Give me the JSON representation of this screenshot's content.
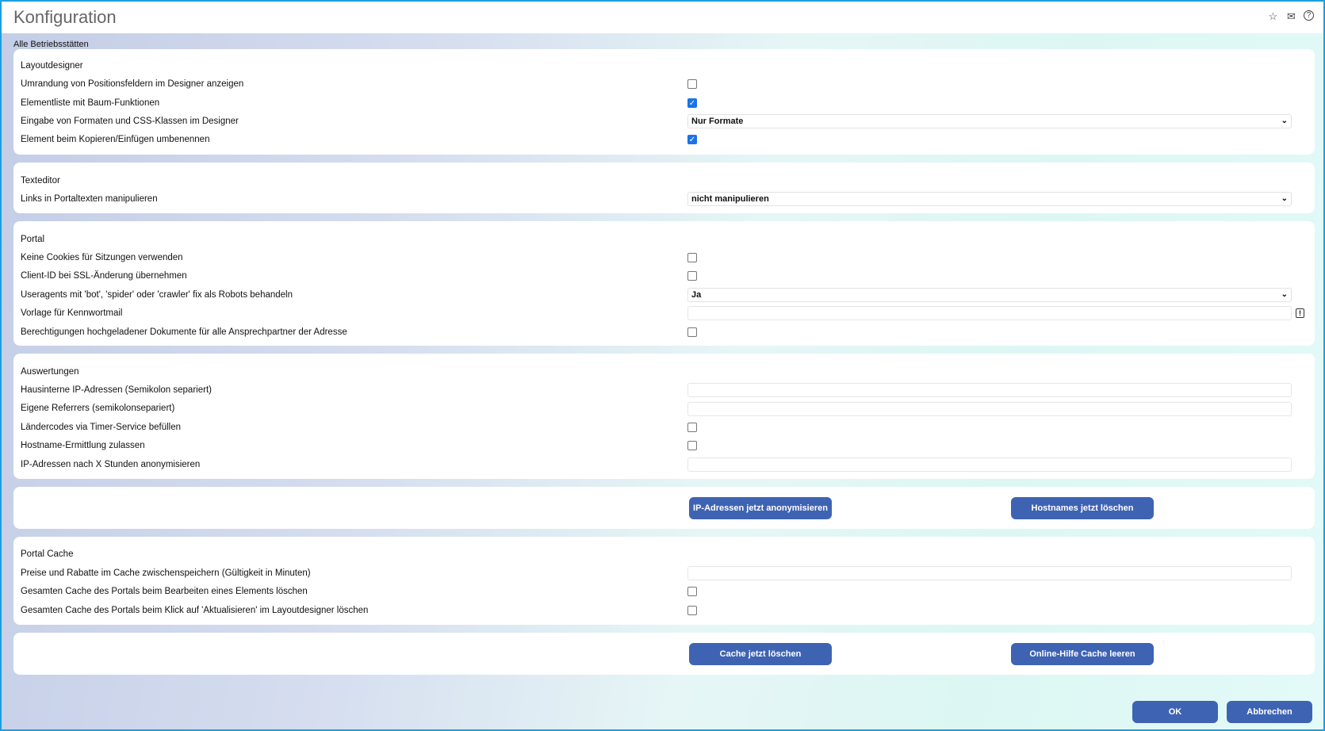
{
  "title": "Konfiguration",
  "scope": "Alle Betriebsstätten",
  "layoutdesigner": {
    "heading": "Layoutdesigner",
    "r1": "Umrandung von Positionsfeldern im Designer anzeigen",
    "r2": "Elementliste mit Baum-Funktionen",
    "r3": "Eingabe von Formaten und CSS-Klassen im Designer",
    "r3_value": "Nur Formate",
    "r4": "Element beim Kopieren/Einfügen umbenennen",
    "r1_checked": false,
    "r2_checked": true,
    "r4_checked": true
  },
  "texteditor": {
    "heading": "Texteditor",
    "r1": "Links in Portaltexten manipulieren",
    "r1_value": "nicht manipulieren"
  },
  "portal": {
    "heading": "Portal",
    "r1": "Keine Cookies für Sitzungen verwenden",
    "r2": "Client-ID bei SSL-Änderung übernehmen",
    "r3": "Useragents mit 'bot', 'spider' oder 'crawler' fix als Robots behandeln",
    "r3_value": "Ja",
    "r4": "Vorlage für Kennwortmail",
    "r4_value": "",
    "r5": "Berechtigungen hochgeladener Dokumente für alle Ansprechpartner der Adresse"
  },
  "auswertungen": {
    "heading": "Auswertungen",
    "r1": "Hausinterne IP-Adressen (Semikolon separiert)",
    "r2": "Eigene Referrers (semikolonsepariert)",
    "r3": "Ländercodes via Timer-Service befüllen",
    "r4": "Hostname-Ermittlung zulassen",
    "r5": "IP-Adressen nach X Stunden anonymisieren",
    "btn1": "IP-Adressen jetzt anonymisieren",
    "btn2": "Hostnames jetzt löschen"
  },
  "cache": {
    "heading": "Portal Cache",
    "r1": "Preise und Rabatte im Cache zwischenspeichern (Gültigkeit in Minuten)",
    "r2": "Gesamten Cache des Portals beim Bearbeiten eines Elements löschen",
    "r3": "Gesamten Cache des Portals beim Klick auf 'Aktualisieren' im Layoutdesigner löschen",
    "btn1": "Cache jetzt löschen",
    "btn2": "Online-Hilfe Cache leeren"
  },
  "footer": {
    "ok": "OK",
    "cancel": "Abbrechen"
  },
  "icons": {
    "star": "☆",
    "mail": "✉",
    "help": "?",
    "chevron": "⌄",
    "check": "✓",
    "warn": "!"
  }
}
